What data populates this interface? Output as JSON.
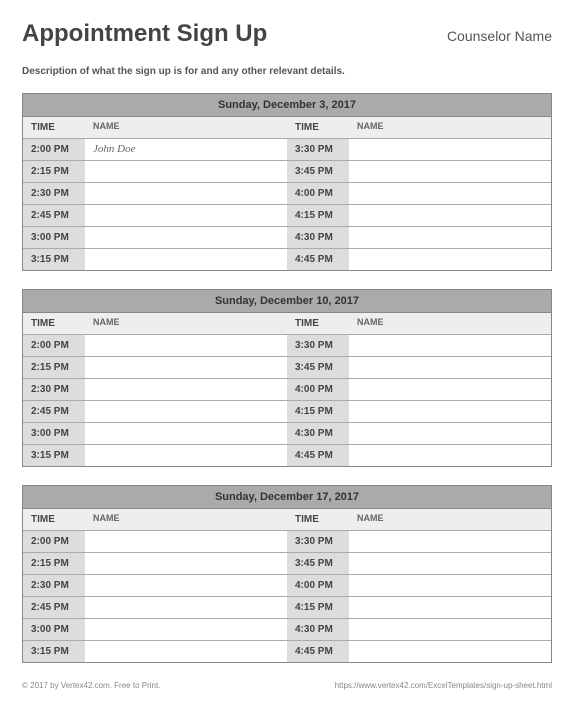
{
  "header": {
    "title": "Appointment Sign Up",
    "counselor": "Counselor Name"
  },
  "description": "Description of what the sign up is for and any other relevant details.",
  "column_labels": {
    "time": "TIME",
    "name": "NAME"
  },
  "days": [
    {
      "date_label": "Sunday, December 3, 2017",
      "left": [
        {
          "time": "2:00 PM",
          "name": "John Doe"
        },
        {
          "time": "2:15 PM",
          "name": ""
        },
        {
          "time": "2:30 PM",
          "name": ""
        },
        {
          "time": "2:45 PM",
          "name": ""
        },
        {
          "time": "3:00 PM",
          "name": ""
        },
        {
          "time": "3:15 PM",
          "name": ""
        }
      ],
      "right": [
        {
          "time": "3:30 PM",
          "name": ""
        },
        {
          "time": "3:45 PM",
          "name": ""
        },
        {
          "time": "4:00 PM",
          "name": ""
        },
        {
          "time": "4:15 PM",
          "name": ""
        },
        {
          "time": "4:30 PM",
          "name": ""
        },
        {
          "time": "4:45 PM",
          "name": ""
        }
      ]
    },
    {
      "date_label": "Sunday, December 10, 2017",
      "left": [
        {
          "time": "2:00 PM",
          "name": ""
        },
        {
          "time": "2:15 PM",
          "name": ""
        },
        {
          "time": "2:30 PM",
          "name": ""
        },
        {
          "time": "2:45 PM",
          "name": ""
        },
        {
          "time": "3:00 PM",
          "name": ""
        },
        {
          "time": "3:15 PM",
          "name": ""
        }
      ],
      "right": [
        {
          "time": "3:30 PM",
          "name": ""
        },
        {
          "time": "3:45 PM",
          "name": ""
        },
        {
          "time": "4:00 PM",
          "name": ""
        },
        {
          "time": "4:15 PM",
          "name": ""
        },
        {
          "time": "4:30 PM",
          "name": ""
        },
        {
          "time": "4:45 PM",
          "name": ""
        }
      ]
    },
    {
      "date_label": "Sunday, December 17, 2017",
      "left": [
        {
          "time": "2:00 PM",
          "name": ""
        },
        {
          "time": "2:15 PM",
          "name": ""
        },
        {
          "time": "2:30 PM",
          "name": ""
        },
        {
          "time": "2:45 PM",
          "name": ""
        },
        {
          "time": "3:00 PM",
          "name": ""
        },
        {
          "time": "3:15 PM",
          "name": ""
        }
      ],
      "right": [
        {
          "time": "3:30 PM",
          "name": ""
        },
        {
          "time": "3:45 PM",
          "name": ""
        },
        {
          "time": "4:00 PM",
          "name": ""
        },
        {
          "time": "4:15 PM",
          "name": ""
        },
        {
          "time": "4:30 PM",
          "name": ""
        },
        {
          "time": "4:45 PM",
          "name": ""
        }
      ]
    }
  ],
  "footer": {
    "left": "© 2017 by Vertex42.com. Free to Print.",
    "right": "https://www.vertex42.com/ExcelTemplates/sign-up-sheet.html"
  }
}
